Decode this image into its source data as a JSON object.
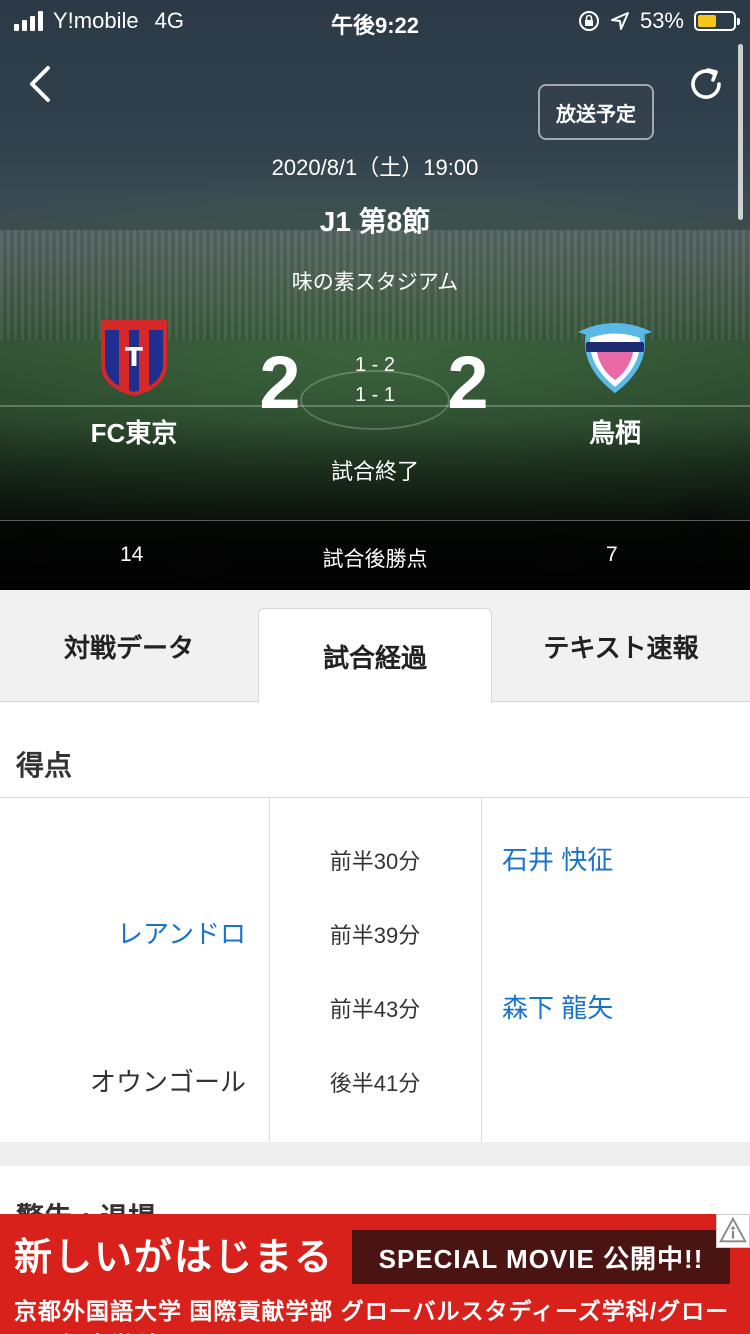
{
  "status_bar": {
    "carrier": "Y!mobile",
    "network": "4G",
    "time": "午後9:22",
    "battery_percent": "53%",
    "battery_level": 0.53
  },
  "header": {
    "broadcast_label": "放送予定",
    "date": "2020/8/1（土）19:00",
    "round": "J1 第8節",
    "venue": "味の素スタジアム"
  },
  "match": {
    "home": {
      "name": "FC東京",
      "score": "2",
      "crest": "fc-tokyo-crest"
    },
    "away": {
      "name": "鳥栖",
      "score": "2",
      "crest": "sagan-tosu-crest"
    },
    "first_half": "1 - 2",
    "second_half": "1 - 1",
    "status": "試合終了",
    "points_label": "試合後勝点",
    "home_points": "14",
    "away_points": "7"
  },
  "tabs": [
    {
      "label": "対戦データ",
      "active": false
    },
    {
      "label": "試合経過",
      "active": true
    },
    {
      "label": "テキスト速報",
      "active": false
    }
  ],
  "goals": {
    "title": "得点",
    "rows": [
      {
        "home": "",
        "time": "前半30分",
        "away": "石井 快征"
      },
      {
        "home": "レアンドロ",
        "time": "前半39分",
        "away": ""
      },
      {
        "home": "",
        "time": "前半43分",
        "away": "森下 龍矢"
      },
      {
        "home": "オウンゴール",
        "time": "後半41分",
        "away": ""
      }
    ]
  },
  "next_section_title": "警告・退場",
  "ad": {
    "headline": "新しいがはじまる",
    "badge": "SPECIAL MOVIE 公開中!!",
    "subline": "京都外国語大学 国際貢献学部 グローバルスタディーズ学科/グローバル観光学科",
    "info_icon": "info-icon"
  },
  "colors": {
    "link": "#1a73c8",
    "ad_red": "#d9211b",
    "tab_bg": "#f1f1f1"
  }
}
